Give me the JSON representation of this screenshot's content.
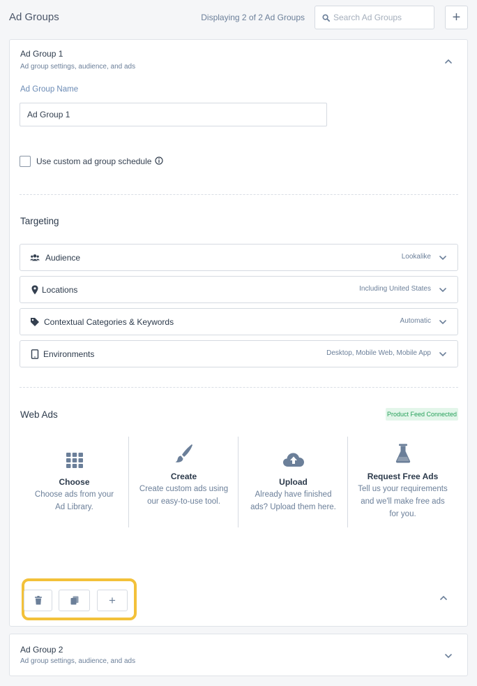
{
  "header": {
    "title": "Ad Groups",
    "count_text": "Displaying 2 of 2 Ad Groups",
    "search_placeholder": "Search Ad Groups",
    "add_label": "+"
  },
  "ad_groups": [
    {
      "title": "Ad Group 1",
      "subtitle": "Ad group settings, audience, and ads",
      "expanded": true,
      "name_label": "Ad Group Name",
      "name_value": "Ad Group 1",
      "schedule_label": "Use custom ad group schedule",
      "schedule_checked": false,
      "targeting": {
        "title": "Targeting",
        "rows": [
          {
            "label": "Audience",
            "value": "Lookalike",
            "icon": "users-icon"
          },
          {
            "label": "Locations",
            "value": "Including United States",
            "icon": "map-pin-icon"
          },
          {
            "label": "Contextual Categories & Keywords",
            "value": "Automatic",
            "icon": "tag-icon"
          },
          {
            "label": "Environments",
            "value": "Desktop, Mobile Web, Mobile App",
            "icon": "tablet-icon"
          }
        ]
      },
      "web_ads": {
        "title": "Web Ads",
        "badge": "Product Feed Connected",
        "badge_color": "#26a05a",
        "options": [
          {
            "title": "Choose",
            "description": "Choose ads from your Ad Library.",
            "icon": "grid-icon"
          },
          {
            "title": "Create",
            "description": "Create custom ads using our easy-to-use tool.",
            "icon": "paintbrush-icon"
          },
          {
            "title": "Upload",
            "description": "Already have finished ads? Upload them here.",
            "icon": "cloud-upload-icon"
          },
          {
            "title": "Request Free Ads",
            "description": "Tell us your requirements and we'll make free ads for you.",
            "icon": "flask-icon"
          }
        ]
      },
      "actions": [
        {
          "name": "delete",
          "icon": "trash-icon"
        },
        {
          "name": "duplicate",
          "icon": "copy-icon"
        },
        {
          "name": "add",
          "label": "+",
          "icon": "plus-icon"
        }
      ]
    },
    {
      "title": "Ad Group 2",
      "subtitle": "Ad group settings, audience, and ads",
      "expanded": false
    }
  ],
  "colors": {
    "accent_label": "#6b8bb5",
    "highlight": "#f3c13a",
    "icon_gray": "#6b7f99"
  }
}
